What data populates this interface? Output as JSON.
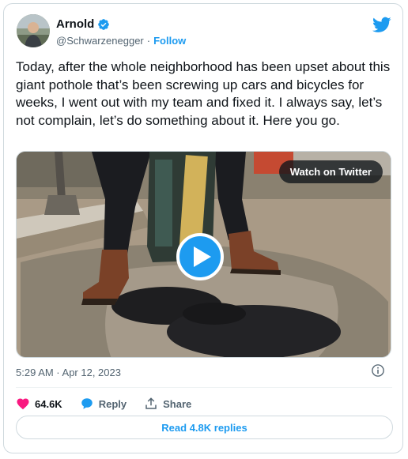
{
  "author": {
    "display_name": "Arnold",
    "handle": "@Schwarzenegger",
    "separator": "·",
    "follow_label": "Follow",
    "verified_icon": "verified-badge-icon",
    "avatar_icon": "avatar-photo"
  },
  "tweet": {
    "text": "Today, after the whole neighborhood has been upset about this giant pothole that’s been screwing up cars and bicycles for weeks, I went out with my team and fixed it. I always say, let’s not complain, let’s do something about it. Here you go."
  },
  "media": {
    "watch_label": "Watch on Twitter",
    "play_icon": "play-icon"
  },
  "meta": {
    "timestamp": "5:29 AM · Apr 12, 2023",
    "info_icon": "info-icon"
  },
  "actions": {
    "like_count": "64.6K",
    "reply_label": "Reply",
    "share_label": "Share"
  },
  "replies": {
    "label": "Read 4.8K replies"
  },
  "colors": {
    "accent": "#1d9bf0",
    "like": "#f91880",
    "text": "#0f1419",
    "muted": "#536471",
    "border": "#cfd9de"
  }
}
